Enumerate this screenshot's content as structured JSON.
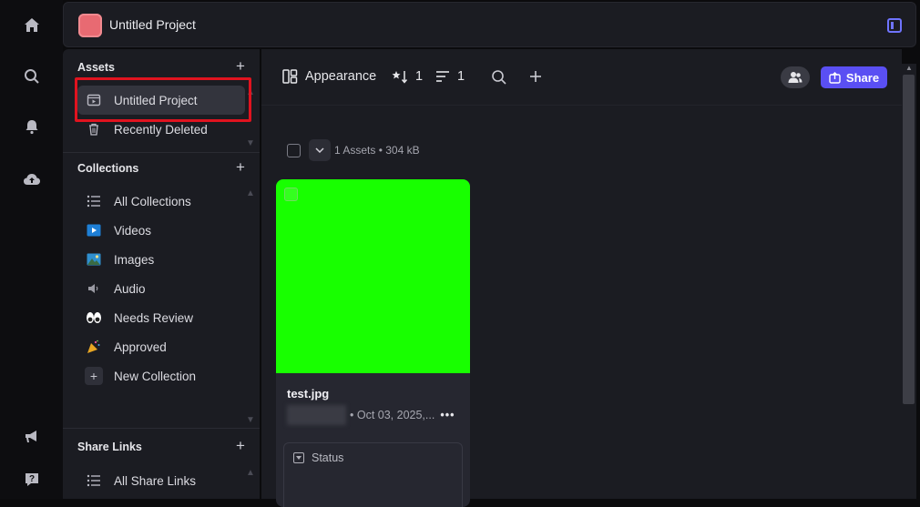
{
  "rail": {
    "icons": [
      "home-icon",
      "search-icon",
      "bell-icon",
      "upload-cloud-icon",
      "megaphone-icon",
      "help-icon"
    ]
  },
  "topbar": {
    "project_title": "Untitled Project"
  },
  "sidebar": {
    "assets": {
      "heading": "Assets",
      "items": [
        {
          "label": "Untitled Project",
          "icon": "project-icon",
          "active": true
        },
        {
          "label": "Recently Deleted",
          "icon": "trash-icon"
        }
      ]
    },
    "collections": {
      "heading": "Collections",
      "items": [
        {
          "label": "All Collections",
          "icon": "list-icon"
        },
        {
          "label": "Videos",
          "icon": "video-icon"
        },
        {
          "label": "Images",
          "icon": "image-icon"
        },
        {
          "label": "Audio",
          "icon": "speaker-icon"
        },
        {
          "label": "Needs Review",
          "icon": "eyes-icon"
        },
        {
          "label": "Approved",
          "icon": "party-icon"
        },
        {
          "label": "New Collection",
          "icon": "plus-icon"
        }
      ]
    },
    "share_links": {
      "heading": "Share Links",
      "items": [
        {
          "label": "All Share Links",
          "icon": "list-icon"
        }
      ]
    }
  },
  "toolbar": {
    "appearance_label": "Appearance",
    "sort_count": "1",
    "filter_count": "1",
    "share_label": "Share"
  },
  "assets_view": {
    "count_label": "1 Assets • 304 kB",
    "card": {
      "filename": "test.jpg",
      "date": "• Oct 03, 2025,...",
      "more": "•••",
      "status_label": "Status",
      "thumbnail_color": "#18ff00"
    }
  },
  "colors": {
    "accent": "#5a4ff3",
    "highlight": "#e0131f",
    "project_thumb": "#e86a72"
  }
}
